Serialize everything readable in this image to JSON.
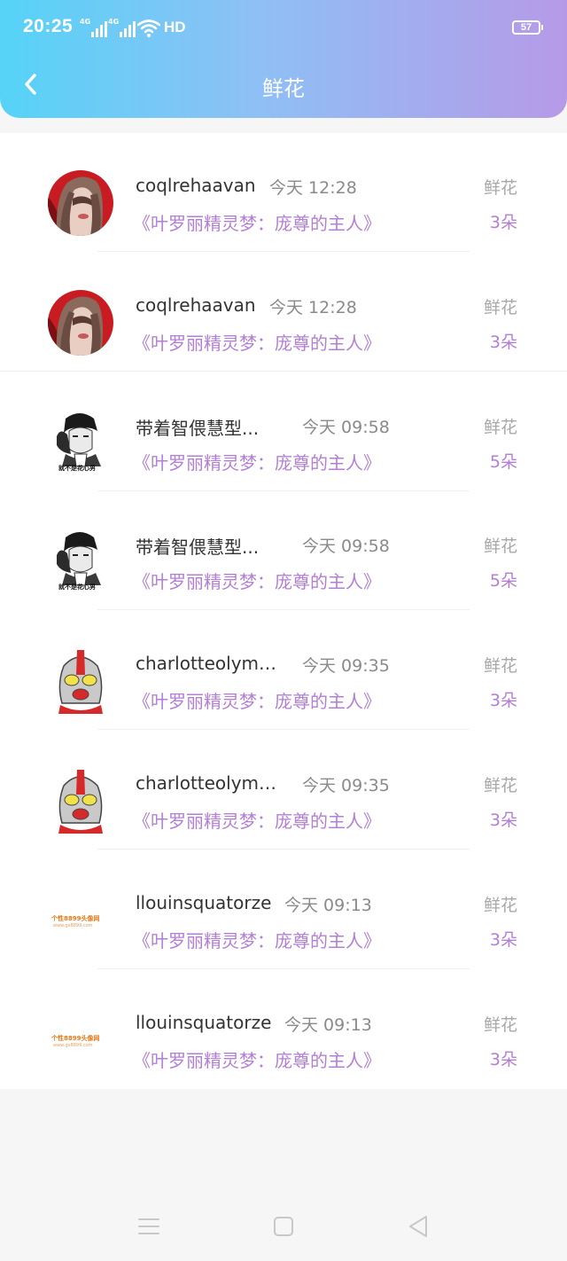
{
  "status_bar": {
    "time": "20:25",
    "network_1": "4G",
    "network_2": "4G",
    "hd": "HD",
    "battery": "57"
  },
  "header": {
    "title": "鲜花",
    "back_icon": "chevron-left-icon"
  },
  "items": [
    {
      "username": "coqlrehaavan",
      "time": "今天 12:28",
      "book": "《叶罗丽精灵梦：庞尊的主人》",
      "gift_type": "鲜花",
      "count": "3朵"
    },
    {
      "username": "coqlrehaavan",
      "time": "今天 12:28",
      "book": "《叶罗丽精灵梦：庞尊的主人》",
      "gift_type": "鲜花",
      "count": "3朵"
    },
    {
      "username": "带着智偎慧型...",
      "time": "今天 09:58",
      "book": "《叶罗丽精灵梦：庞尊的主人》",
      "gift_type": "鲜花",
      "count": "5朵"
    },
    {
      "username": "带着智偎慧型...",
      "time": "今天 09:58",
      "book": "《叶罗丽精灵梦：庞尊的主人》",
      "gift_type": "鲜花",
      "count": "5朵"
    },
    {
      "username": "charlotteolymu...",
      "time": "今天 09:35",
      "book": "《叶罗丽精灵梦：庞尊的主人》",
      "gift_type": "鲜花",
      "count": "3朵"
    },
    {
      "username": "charlotteolymu...",
      "time": "今天 09:35",
      "book": "《叶罗丽精灵梦：庞尊的主人》",
      "gift_type": "鲜花",
      "count": "3朵"
    },
    {
      "username": "llouinsquatorze",
      "time": "今天 09:13",
      "book": "《叶罗丽精灵梦：庞尊的主人》",
      "gift_type": "鲜花",
      "count": "3朵"
    },
    {
      "username": "llouinsquatorze",
      "time": "今天 09:13",
      "book": "《叶罗丽精灵梦：庞尊的主人》",
      "gift_type": "鲜花",
      "count": "3朵"
    }
  ],
  "avatar_text": {
    "sketch_caption": "就不是花心男",
    "logo_line1": "个性8899头像网",
    "logo_line2": "www.gx8899.com"
  },
  "nav_bar": {
    "menu_icon": "menu-icon",
    "home_icon": "square-home-icon",
    "back_icon": "triangle-back-icon"
  },
  "colors": {
    "header_gradient_start": "#56d3f7",
    "header_gradient_end": "#b69ae8",
    "accent_purple": "#b37fd6",
    "text_dark": "#333333",
    "text_gray": "#8a8a8a"
  }
}
